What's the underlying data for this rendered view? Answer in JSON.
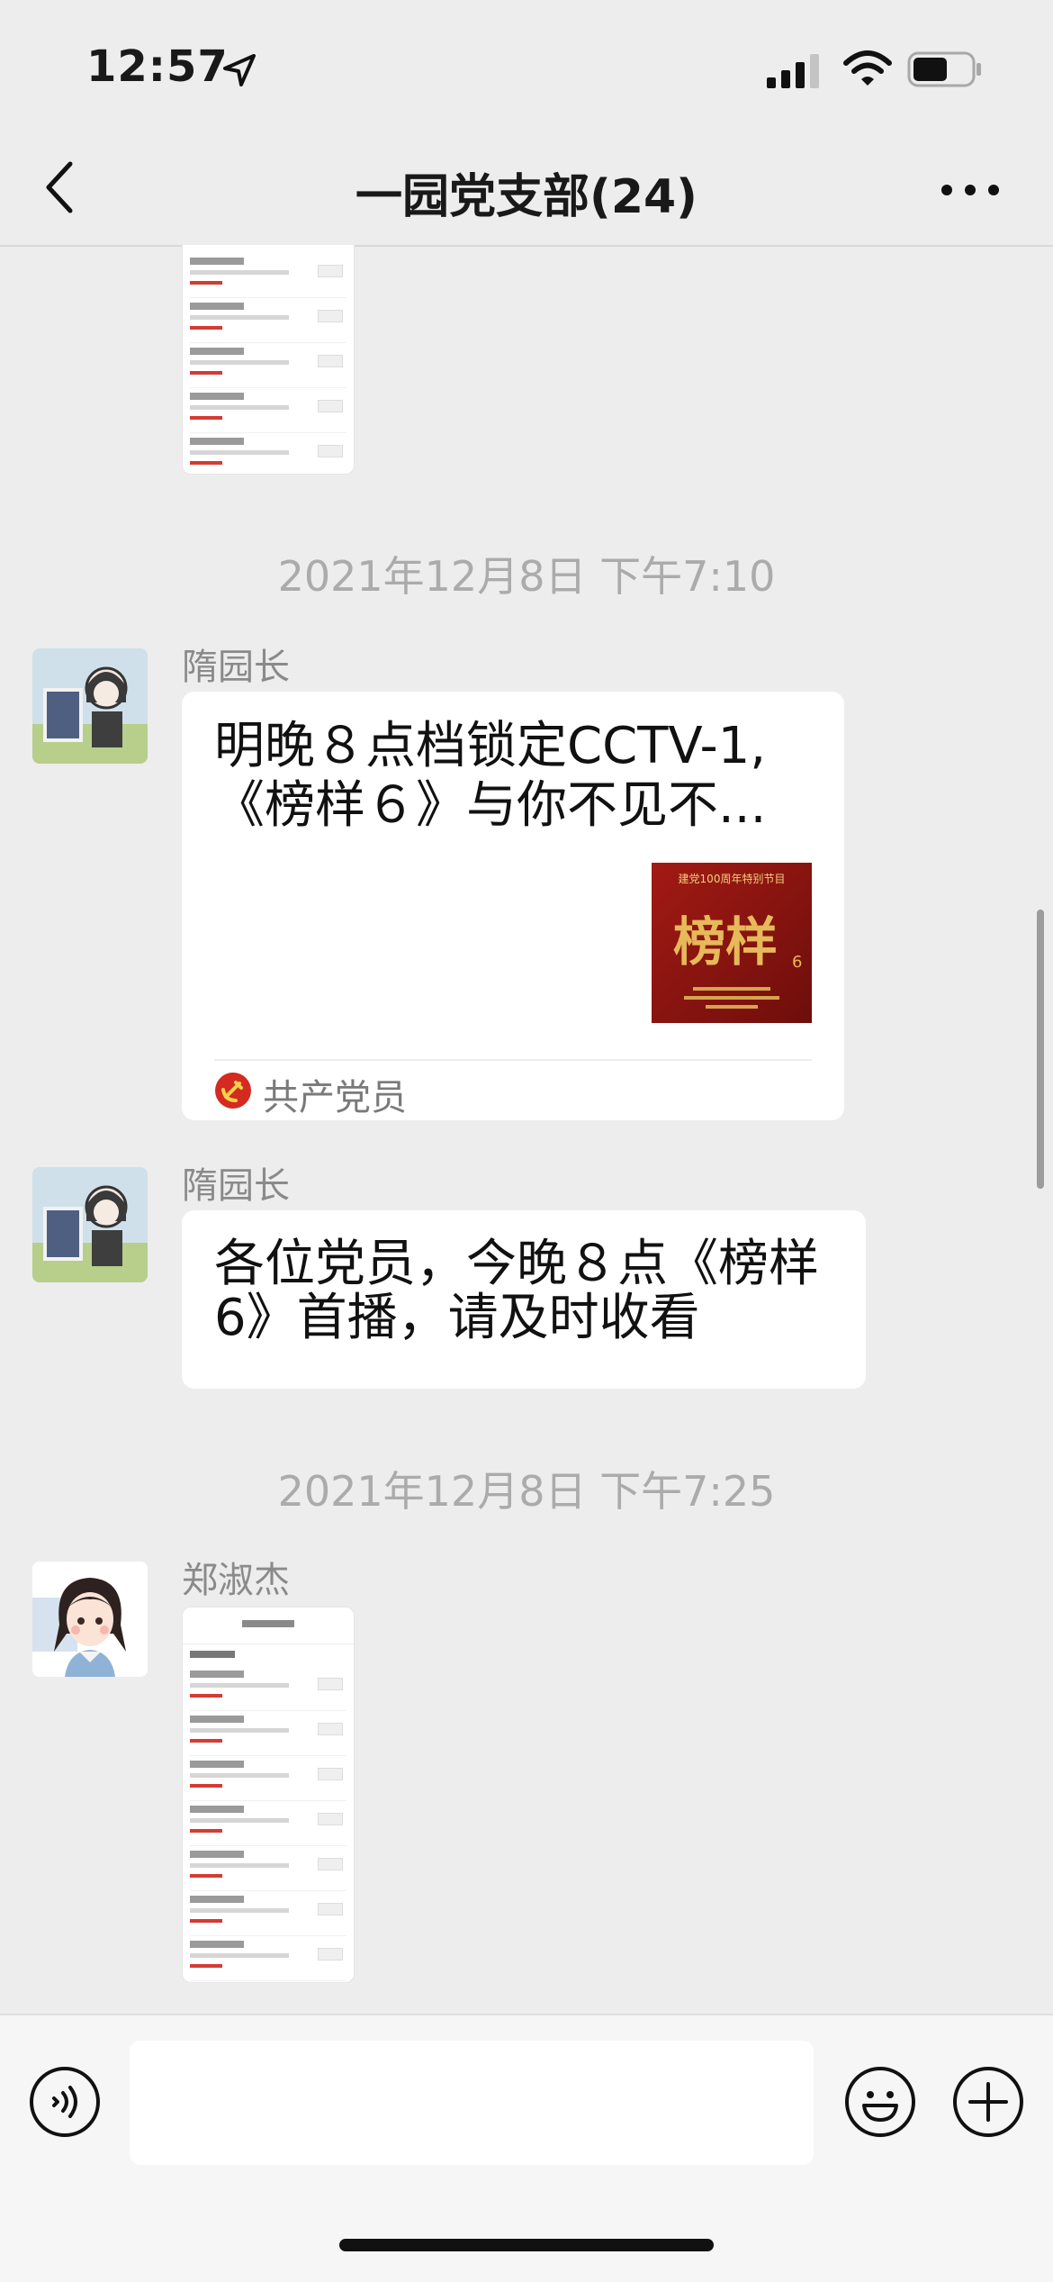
{
  "status_bar": {
    "time": "12:57",
    "battery_level": 0.6
  },
  "nav": {
    "title": "一园党支部(24)"
  },
  "messages": [
    {
      "type": "timestamp",
      "text": "2021年12月8日 下午7:10"
    },
    {
      "type": "link",
      "sender": "隋园长",
      "title": "明晚８点档锁定CCTV-1,《榜样６》与你不见不...",
      "thumb_caption": "榜样",
      "thumb_number": "6",
      "thumb_header": "建党100周年特别节目",
      "source": "共产党员"
    },
    {
      "type": "text",
      "sender": "隋园长",
      "text": "各位党员，今晚８点《榜样6》首播，请及时收看"
    },
    {
      "type": "timestamp",
      "text": "2021年12月8日 下午7:25"
    },
    {
      "type": "image",
      "sender": "郑淑杰"
    }
  ],
  "input_bar": {
    "placeholder": ""
  },
  "colors": {
    "background": "#ededed",
    "bubble": "#ffffff",
    "accent_red": "#c8201c",
    "timestamp_text": "#ababab"
  }
}
